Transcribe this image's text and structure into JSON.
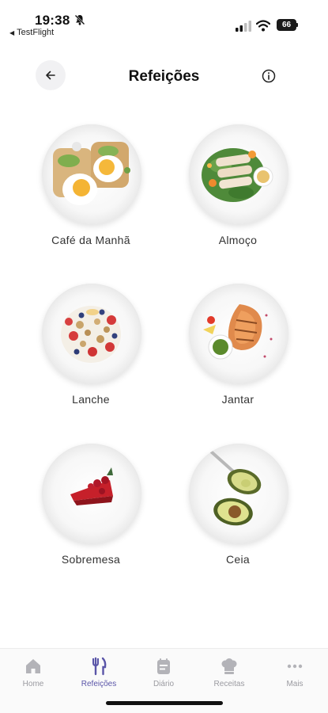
{
  "status_bar": {
    "time": "19:38",
    "back_app": "TestFlight",
    "battery": "66"
  },
  "header": {
    "title": "Refeições",
    "back_icon": "arrow-left-icon",
    "info_icon": "info-icon"
  },
  "meals": [
    {
      "label": "Café da Manhã",
      "image": "breakfast-eggs-avocado-toast"
    },
    {
      "label": "Almoço",
      "image": "chicken-salad-plate"
    },
    {
      "label": "Lanche",
      "image": "yogurt-granola-berries"
    },
    {
      "label": "Jantar",
      "image": "grilled-salmon-plate"
    },
    {
      "label": "Sobremesa",
      "image": "cake-slice-berries"
    },
    {
      "label": "Ceia",
      "image": "avocado-halves"
    }
  ],
  "bottom_nav": {
    "active": "Refeições",
    "active_color": "#5a55a8",
    "items": [
      {
        "label": "Home",
        "icon": "home-icon"
      },
      {
        "label": "Refeições",
        "icon": "fork-knife-icon"
      },
      {
        "label": "Diário",
        "icon": "journal-icon"
      },
      {
        "label": "Receitas",
        "icon": "chef-hat-icon"
      },
      {
        "label": "Mais",
        "icon": "more-dots-icon"
      }
    ]
  }
}
